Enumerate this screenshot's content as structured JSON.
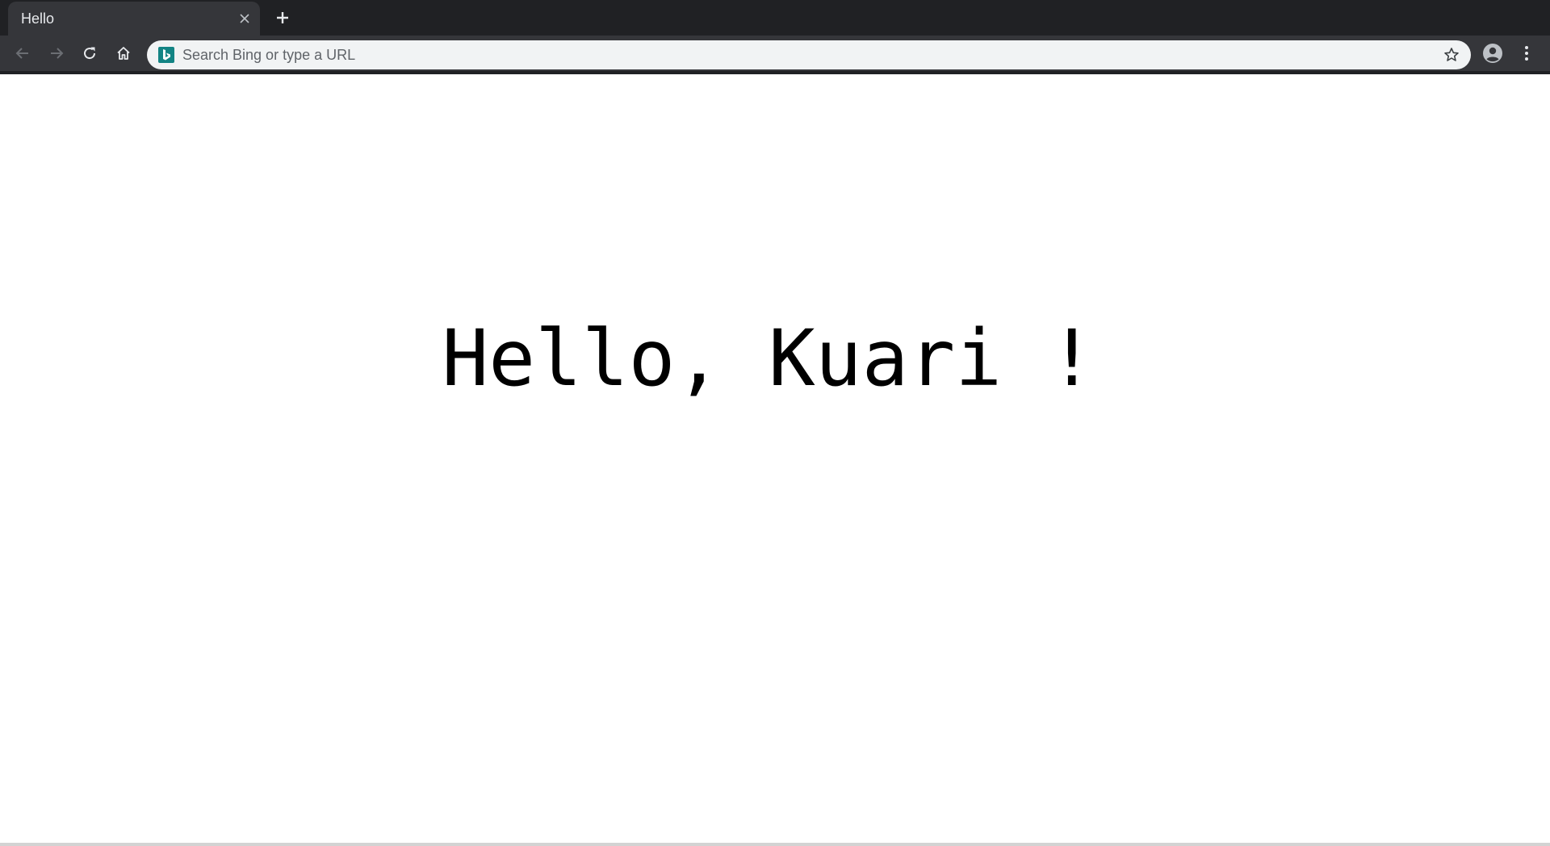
{
  "tab": {
    "title": "Hello"
  },
  "omnibox": {
    "placeholder": "Search Bing or type a URL",
    "value": "",
    "search_engine_icon": "bing-logo-icon"
  },
  "toolbar": {
    "icons": [
      "back-arrow-icon",
      "forward-arrow-icon",
      "reload-icon",
      "home-icon",
      "star-icon",
      "profile-avatar-icon",
      "kebab-menu-icon"
    ]
  },
  "page": {
    "greeting": "Hello, Kuari !"
  },
  "colors": {
    "tabstrip": "#202124",
    "toolbar": "#35363a",
    "omnibox": "#f1f3f4",
    "bing_accent": "#138484",
    "page_bg": "#ffffff",
    "text": "#000000"
  }
}
